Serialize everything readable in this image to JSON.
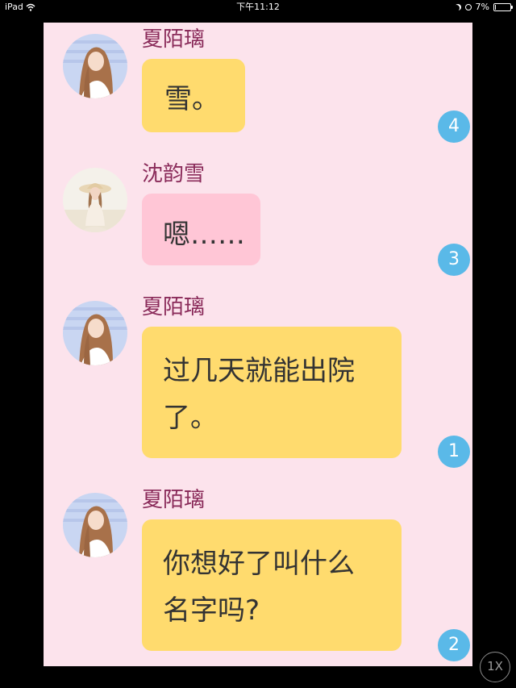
{
  "status_bar": {
    "device": "iPad",
    "time": "下午11:12",
    "battery": "7%",
    "battery_level": 0.07,
    "icons": [
      "wifi-icon",
      "moon-icon",
      "alarm-icon",
      "battery-icon"
    ]
  },
  "chat": {
    "background_color": "#fce3ec",
    "messages": [
      {
        "sender": "夏陌璃",
        "lines": [
          "雪。"
        ],
        "bubble_color": "#ffdb6e",
        "badge": "4",
        "avatar": "avatar-girl-long-hair"
      },
      {
        "sender": "沈韵雪",
        "lines": [
          "嗯……"
        ],
        "bubble_color": "#ffc6d6",
        "badge": "3",
        "avatar": "avatar-girl-sunhat"
      },
      {
        "sender": "夏陌璃",
        "lines": [
          "过几天就能出院",
          "了。"
        ],
        "bubble_color": "#ffdb6e",
        "badge": "1",
        "avatar": "avatar-girl-long-hair"
      },
      {
        "sender": "夏陌璃",
        "lines": [
          "你想好了叫什么",
          "名字吗?"
        ],
        "bubble_color": "#ffdb6e",
        "badge": "2",
        "avatar": "avatar-girl-long-hair"
      }
    ]
  },
  "zoom_button": {
    "label": "1X"
  },
  "colors": {
    "sender_name": "#8a2b5a",
    "badge": "#5ab9e8",
    "message_text": "#333333"
  }
}
